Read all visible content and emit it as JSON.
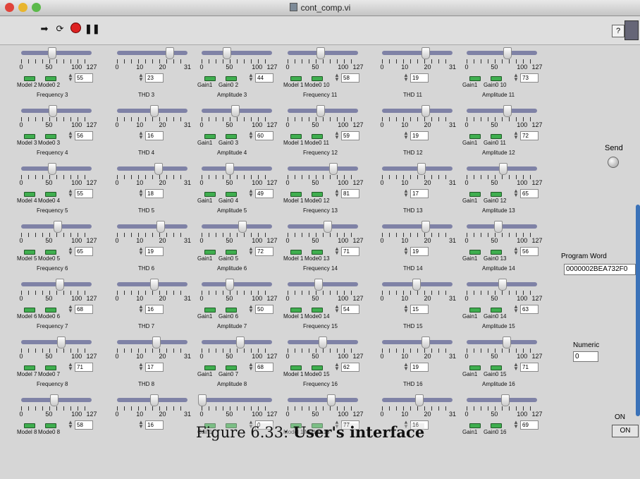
{
  "window": {
    "title": "cont_comp.vi"
  },
  "toolbar": {
    "run_icon": "run-arrow-icon",
    "run_continuous_icon": "run-continuous-icon",
    "abort_icon": "abort-icon",
    "pause_icon": "pause-icon",
    "help_label": "?"
  },
  "colors": {
    "slider_track": "#7f82a6",
    "switch_green": "#3fae4f",
    "panel": "#d6d6d6"
  },
  "columns": [
    {
      "kind": "frequency",
      "ticks": [
        "0",
        "50",
        "100",
        "127"
      ],
      "max": 127,
      "rows": [
        {
          "value": 55,
          "label1": "Model 2",
          "label2": "Mode0 2",
          "caption": "Frequency 3"
        },
        {
          "value": 56,
          "label1": "Model 3",
          "label2": "Mode0 3",
          "caption": "Frequency 4"
        },
        {
          "value": 55,
          "label1": "Model 4",
          "label2": "Mode0 4",
          "caption": "Frequency 5"
        },
        {
          "value": 65,
          "label1": "Model 5",
          "label2": "Mode0 5",
          "caption": "Frequency 6"
        },
        {
          "value": 68,
          "label1": "Model 6",
          "label2": "Mode0 6",
          "caption": "Frequency 7"
        },
        {
          "value": 71,
          "label1": "Model 7",
          "label2": "Mode0 7",
          "caption": "Frequency 8"
        },
        {
          "value": 58,
          "label1": "Model 8",
          "label2": "Mode0 8",
          "caption": ""
        }
      ]
    },
    {
      "kind": "thd",
      "ticks": [
        "0",
        "10",
        "20",
        "31"
      ],
      "max": 31,
      "rows": [
        {
          "value": 23,
          "caption": "THD 3"
        },
        {
          "value": 16,
          "caption": "THD 4"
        },
        {
          "value": 18,
          "caption": "THD 5"
        },
        {
          "value": 19,
          "caption": "THD 6"
        },
        {
          "value": 16,
          "caption": "THD 7"
        },
        {
          "value": 17,
          "caption": "THD 8"
        },
        {
          "value": 16,
          "caption": ""
        }
      ]
    },
    {
      "kind": "amplitude",
      "ticks": [
        "0",
        "50",
        "100",
        "127"
      ],
      "max": 127,
      "rows": [
        {
          "value": 44,
          "label1": "Gain1",
          "label2": "Gain0 2",
          "caption": "Amplitude 3"
        },
        {
          "value": 60,
          "label1": "Gain1",
          "label2": "Gain0 3",
          "caption": "Amplitude 4"
        },
        {
          "value": 49,
          "label1": "Gain1",
          "label2": "Gain0 4",
          "caption": "Amplitude 5"
        },
        {
          "value": 72,
          "label1": "Gain1",
          "label2": "Gain0 5",
          "caption": "Amplitude 6"
        },
        {
          "value": 50,
          "label1": "Gain1",
          "label2": "Gain0 6",
          "caption": "Amplitude 7"
        },
        {
          "value": 68,
          "label1": "Gain1",
          "label2": "Gain0 7",
          "caption": "Amplitude 8"
        },
        {
          "value": 0,
          "label1": "Gain1",
          "label2": "",
          "caption": ""
        }
      ]
    },
    {
      "kind": "frequency",
      "ticks": [
        "0",
        "50",
        "100",
        "127"
      ],
      "max": 127,
      "rows": [
        {
          "value": 58,
          "label1": "Model 1",
          "label2": "Mode0 10",
          "caption": "Frequency 11"
        },
        {
          "value": 59,
          "label1": "Model 1",
          "label2": "Mode0 11",
          "caption": "Frequency 12"
        },
        {
          "value": 81,
          "label1": "Model 1",
          "label2": "Mode0 12",
          "caption": "Frequency 13"
        },
        {
          "value": 71,
          "label1": "Model 1",
          "label2": "Mode0 13",
          "caption": "Frequency 14"
        },
        {
          "value": 54,
          "label1": "Model 1",
          "label2": "Mode0 14",
          "caption": "Frequency 15"
        },
        {
          "value": 62,
          "label1": "Model 1",
          "label2": "Mode0 15",
          "caption": "Frequency 16"
        },
        {
          "value": 77,
          "label1": "Model 1",
          "label2": "Mode0 16",
          "caption": ""
        }
      ]
    },
    {
      "kind": "thd",
      "ticks": [
        "0",
        "10",
        "20",
        "31"
      ],
      "max": 31,
      "rows": [
        {
          "value": 19,
          "caption": "THD 11"
        },
        {
          "value": 19,
          "caption": "THD 12"
        },
        {
          "value": 17,
          "caption": "THD 13"
        },
        {
          "value": 19,
          "caption": "THD 14"
        },
        {
          "value": 15,
          "caption": "THD 15"
        },
        {
          "value": 19,
          "caption": "THD 16"
        },
        {
          "value": 16,
          "caption": ""
        }
      ]
    },
    {
      "kind": "amplitude",
      "ticks": [
        "0",
        "50",
        "100",
        "127"
      ],
      "max": 127,
      "rows": [
        {
          "value": 73,
          "label1": "Gain1",
          "label2": "Gain0 10",
          "caption": "Amplitude 11"
        },
        {
          "value": 72,
          "label1": "Gain1",
          "label2": "Gain0 11",
          "caption": "Amplitude 12"
        },
        {
          "value": 65,
          "label1": "Gain1",
          "label2": "Gain0 12",
          "caption": "Amplitude 13"
        },
        {
          "value": 56,
          "label1": "Gain1",
          "label2": "Gain0 13",
          "caption": "Amplitude 14"
        },
        {
          "value": 63,
          "label1": "Gain1",
          "label2": "Gain0 14",
          "caption": "Amplitude 15"
        },
        {
          "value": 71,
          "label1": "Gain1",
          "label2": "Gain0 15",
          "caption": "Amplitude 16"
        },
        {
          "value": 69,
          "label1": "Gain1",
          "label2": "Gain0 16",
          "caption": ""
        }
      ]
    }
  ],
  "send": {
    "label": "Send"
  },
  "program_word": {
    "label": "Program Word",
    "value": "0000002BEA732F0"
  },
  "numeric": {
    "label": "Numeric",
    "value": "0"
  },
  "on_switch": {
    "label": "ON",
    "button_text": "ON"
  },
  "figure_caption": {
    "prefix": "Figure 6.33: ",
    "bold": "User's interface"
  }
}
